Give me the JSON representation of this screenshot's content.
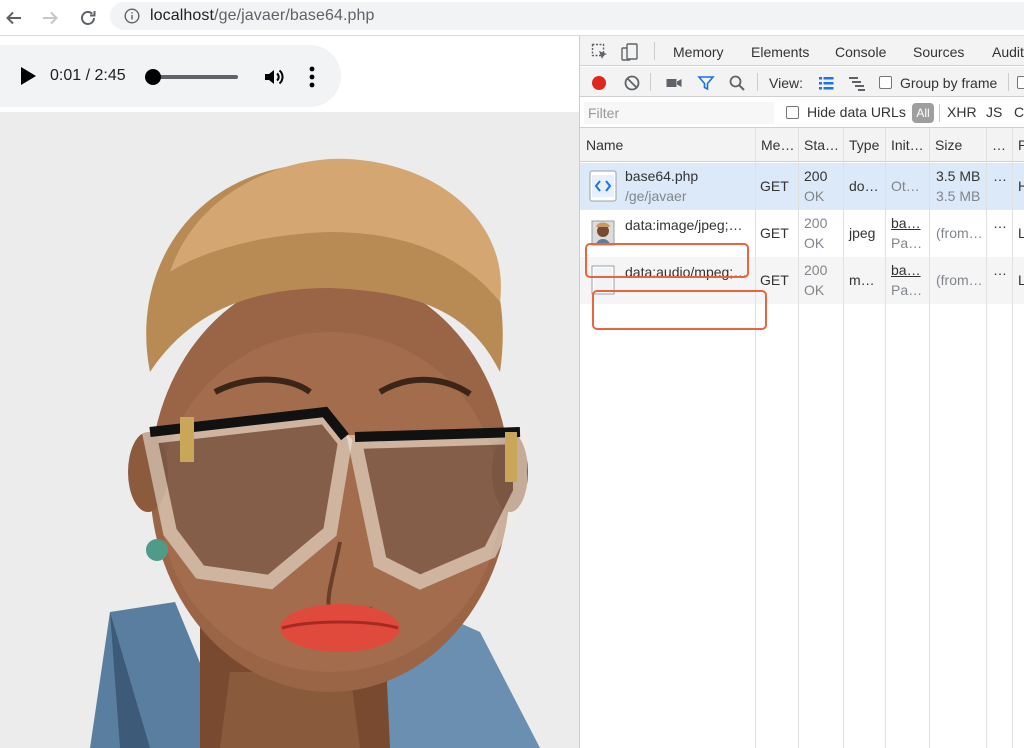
{
  "browser": {
    "url_host": "localhost",
    "url_path": "/ge/javaer/base64.php"
  },
  "audio_player": {
    "time": "0:01 / 2:45",
    "progress": 0.006
  },
  "devtools": {
    "tabs": [
      "Memory",
      "Elements",
      "Console",
      "Sources",
      "Audit"
    ],
    "toolbar": {
      "view_label": "View:",
      "group_by_frame": "Group by frame"
    },
    "filter": {
      "placeholder": "Filter",
      "hide_data_urls": "Hide data URLs",
      "all": "All",
      "xhr": "XHR",
      "js": "JS",
      "css": "C"
    },
    "columns": [
      "Name",
      "Me…",
      "Sta…",
      "Type",
      "Init…",
      "Size",
      "…",
      "P"
    ],
    "rows": [
      {
        "name": "base64.php",
        "path": "/ge/javaer",
        "method": "GET",
        "status": "200",
        "status_text": "OK",
        "type": "do…",
        "initiator": "Ot…",
        "initiator2": "",
        "size": "3.5 MB",
        "size2": "3.5 MB",
        "more": "…",
        "p": "H",
        "icon": "document-icon"
      },
      {
        "name": "data:image/jpeg;…",
        "path": "",
        "method": "GET",
        "status": "200",
        "status_text": "OK",
        "type": "jpeg",
        "initiator": "ba…",
        "initiator2": "Pa…",
        "size": "(from…",
        "size2": "",
        "more": "…",
        "p": "L",
        "icon": "image-thumbnail-icon"
      },
      {
        "name": "data:audio/mpeg;…",
        "path": "",
        "method": "GET",
        "status": "200",
        "status_text": "OK",
        "type": "m…",
        "initiator": "ba…",
        "initiator2": "Pa…",
        "size": "(from…",
        "size2": "",
        "more": "…",
        "p": "L",
        "icon": "blank-file-icon"
      }
    ]
  },
  "colors": {
    "highlight": "#e8653d",
    "selected_row": "#dce9f8",
    "record": "#e0271e",
    "filter_active": "#1a73e8"
  }
}
